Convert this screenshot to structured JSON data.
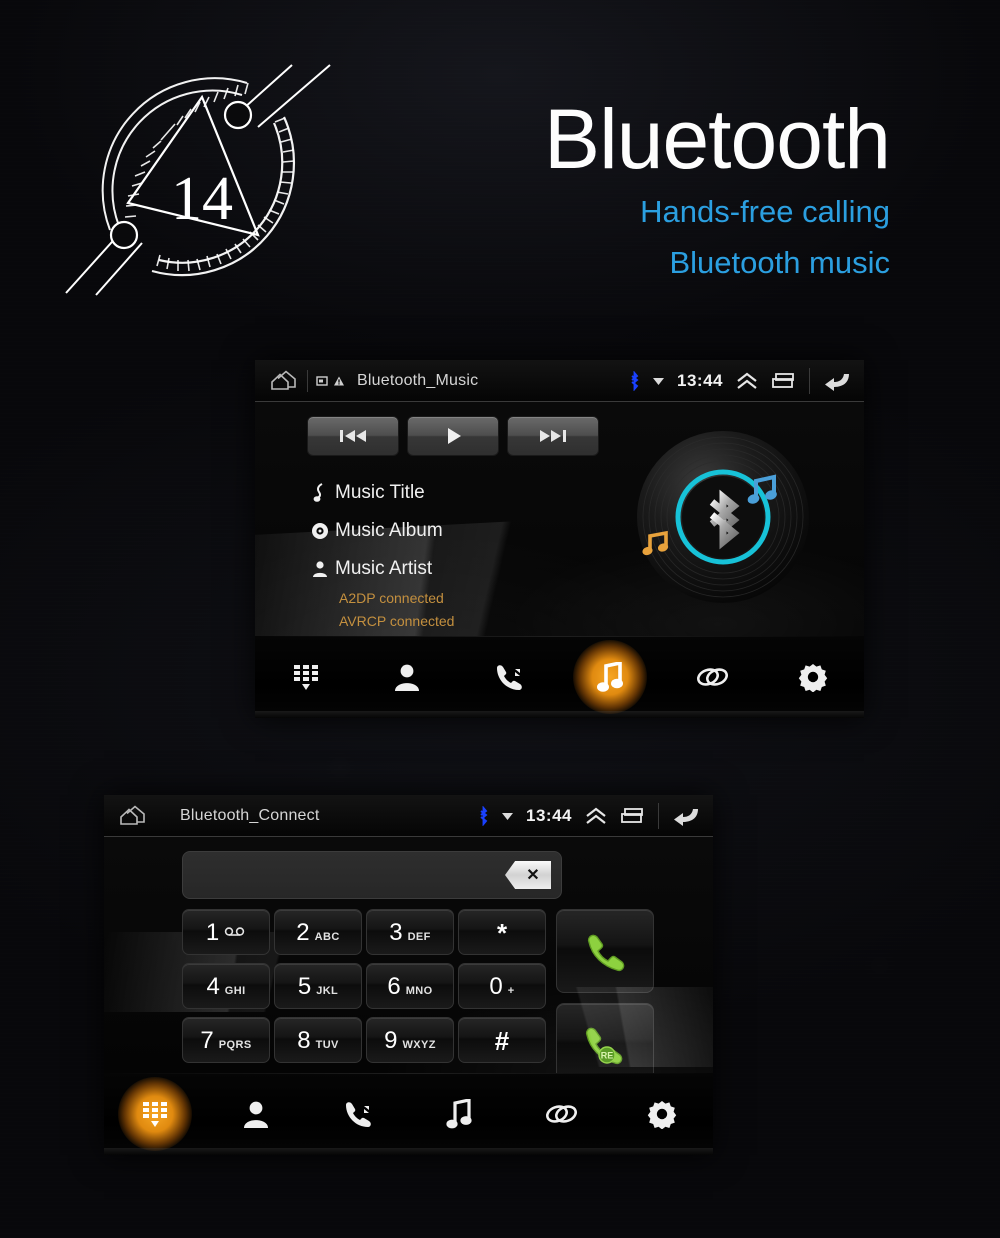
{
  "hero": {
    "badge_number": "14",
    "title": "Bluetooth",
    "subtitle_line1": "Hands-free calling",
    "subtitle_line2": "Bluetooth music",
    "title_color": "#fdfdfd",
    "subtitle_color": "#2b9fe0"
  },
  "music_screen": {
    "statusbar": {
      "home_icon": "home-icon",
      "sdcard_icon": "sdcard-icon",
      "warning_icon": "warning-icon",
      "title": "Bluetooth_Music",
      "bluetooth_icon": "bluetooth-icon",
      "dropdown_icon": "triangle-down-icon",
      "time": "13:44",
      "expand_icon": "double-chevron-up-icon",
      "recents_icon": "recents-icon",
      "back_icon": "back-arrow-icon"
    },
    "transport": {
      "previous_label": "previous-track",
      "play_label": "play",
      "next_label": "next-track"
    },
    "track": {
      "title": "Music Title",
      "album": "Music Album",
      "artist": "Music Artist"
    },
    "connection_status": [
      "A2DP connected",
      "AVRCP connected"
    ],
    "status_color": "#c4903f",
    "artwork": {
      "type": "vinyl-record",
      "ring_color": "#17c2d8",
      "center_icon": "bluetooth-glyph",
      "note_blue_color": "#4a9fd8",
      "note_orange_color": "#e8a23c"
    },
    "navbar": {
      "active": "music",
      "items": [
        {
          "id": "dialpad",
          "icon": "dialpad-icon",
          "active": false
        },
        {
          "id": "contacts",
          "icon": "contacts-icon",
          "active": false
        },
        {
          "id": "history",
          "icon": "call-history-icon",
          "active": false
        },
        {
          "id": "music",
          "icon": "music-note-icon",
          "active": true
        },
        {
          "id": "link",
          "icon": "link-icon",
          "active": false
        },
        {
          "id": "settings",
          "icon": "gear-icon",
          "active": false
        }
      ],
      "active_glow_color": "#f7a623"
    }
  },
  "dial_screen": {
    "statusbar": {
      "home_icon": "home-icon",
      "title": "Bluetooth_Connect",
      "bluetooth_icon": "bluetooth-icon",
      "dropdown_icon": "triangle-down-icon",
      "time": "13:44",
      "expand_icon": "double-chevron-up-icon",
      "recents_icon": "recents-icon",
      "back_icon": "back-arrow-icon"
    },
    "number_input": {
      "value": "",
      "placeholder": "",
      "backspace_label": "✕"
    },
    "keys": [
      {
        "digit": "1",
        "sub": "◡◡",
        "sub_is_voicemail": true
      },
      {
        "digit": "2",
        "sub": "ABC"
      },
      {
        "digit": "3",
        "sub": "DEF"
      },
      {
        "digit": "*",
        "sub": ""
      },
      {
        "digit": "4",
        "sub": "GHI"
      },
      {
        "digit": "5",
        "sub": "JKL"
      },
      {
        "digit": "6",
        "sub": "MNO"
      },
      {
        "digit": "0",
        "sub": "+"
      },
      {
        "digit": "7",
        "sub": "PQRS"
      },
      {
        "digit": "8",
        "sub": "TUV"
      },
      {
        "digit": "9",
        "sub": "WXYZ"
      },
      {
        "digit": "#",
        "sub": ""
      }
    ],
    "call_buttons": [
      {
        "id": "call",
        "icon": "handset-call-icon",
        "badge": ""
      },
      {
        "id": "redial",
        "icon": "handset-redial-icon",
        "badge": "RE"
      }
    ],
    "call_button_color": "#7fc93a",
    "navbar": {
      "active": "dialpad",
      "items": [
        {
          "id": "dialpad",
          "icon": "dialpad-icon",
          "active": true
        },
        {
          "id": "contacts",
          "icon": "contacts-icon",
          "active": false
        },
        {
          "id": "history",
          "icon": "call-history-icon",
          "active": false
        },
        {
          "id": "music",
          "icon": "music-note-icon",
          "active": false
        },
        {
          "id": "link",
          "icon": "link-icon",
          "active": false
        },
        {
          "id": "settings",
          "icon": "gear-icon",
          "active": false
        }
      ],
      "active_glow_color": "#f7a623"
    }
  }
}
